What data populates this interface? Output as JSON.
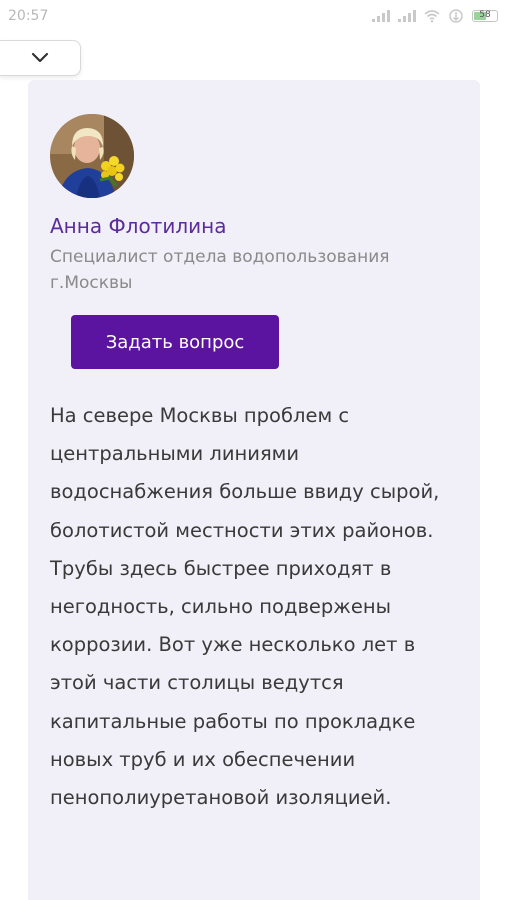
{
  "status_bar": {
    "time": "20:57",
    "battery_level": "58",
    "battery_fraction": 0.58
  },
  "collapse_toggle": {
    "icon": "chevron-down-icon"
  },
  "expert": {
    "name": "Анна Флотилина",
    "role": "Специалист отдела водопользования г.Москвы",
    "avatar": "expert-photo"
  },
  "ask_button": {
    "label": "Задать вопрос",
    "color": "#5b14a0"
  },
  "article": {
    "text": "На севере Москвы проблем с центральными линиями водоснабжения больше ввиду сырой, болотистой местности этих районов. Трубы здесь быстрее приходят в негодность, сильно подвержены коррозии. Вот уже несколько лет в этой части столицы ведутся капитальные работы по прокладке новых труб и их обеспечении пенополиуретановой изоляцией."
  },
  "colors": {
    "card_background": "#f1eff7",
    "name_color": "#5a2d9a",
    "accent": "#5b14a0"
  }
}
